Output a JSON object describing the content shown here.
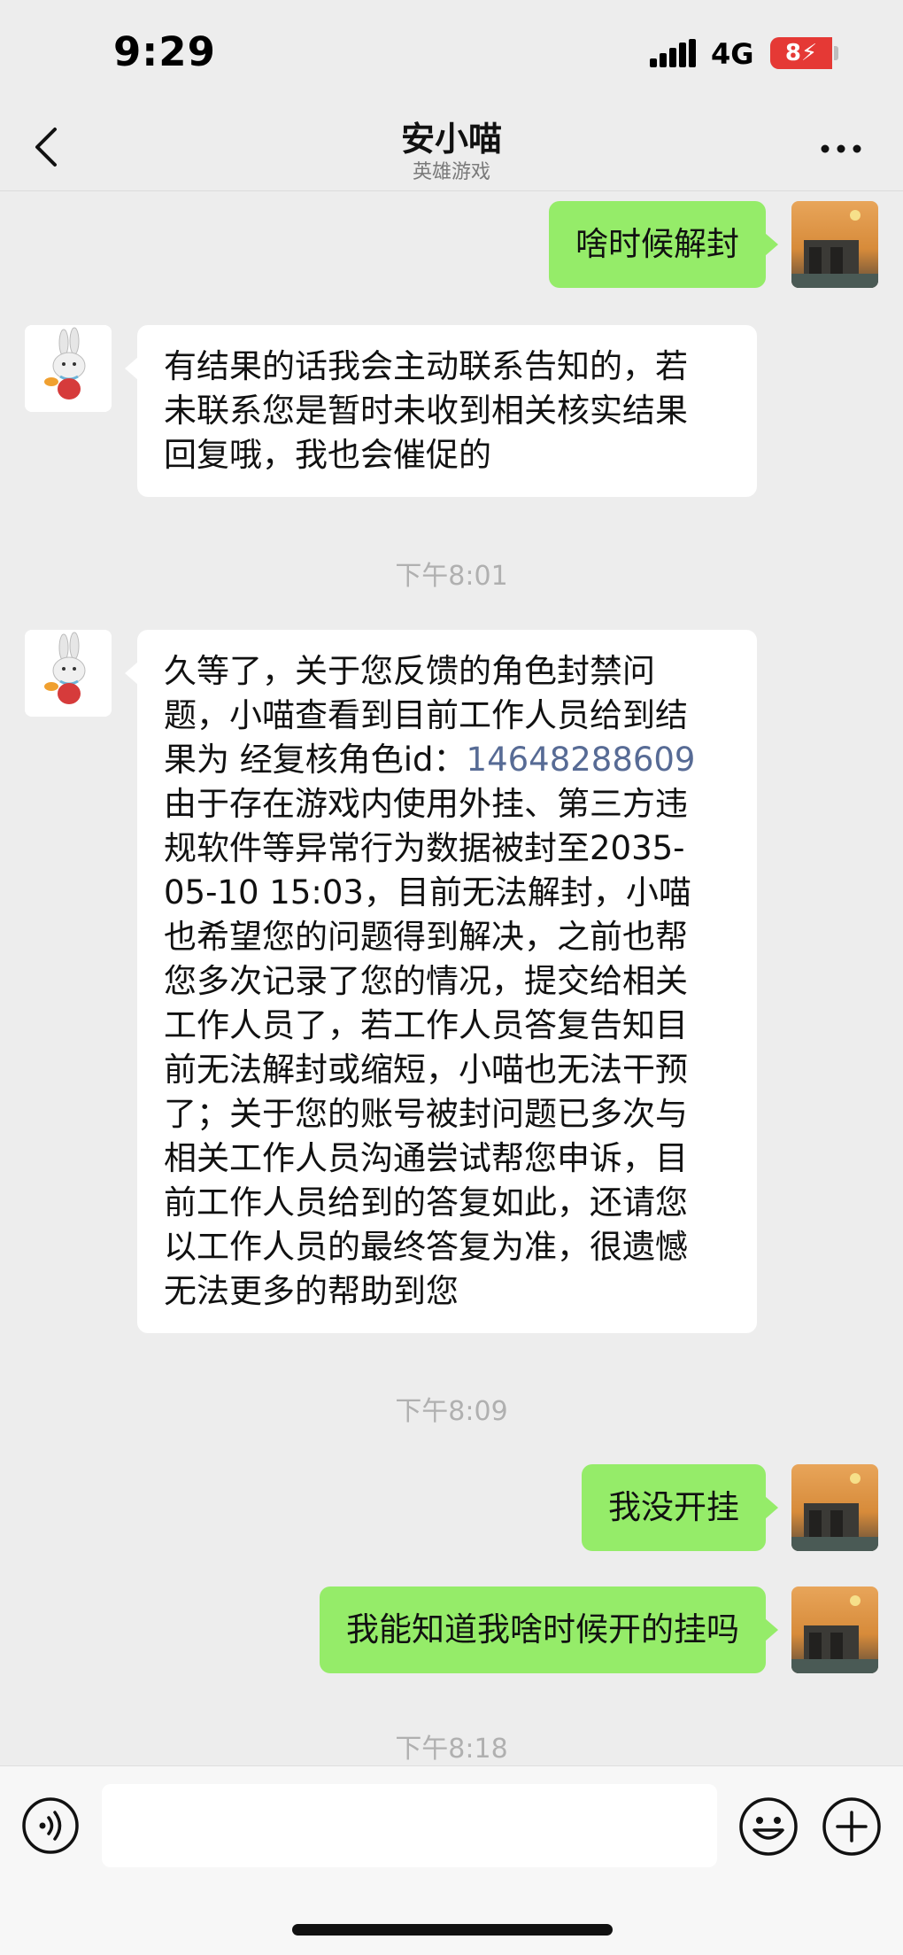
{
  "status_bar": {
    "time": "9:29",
    "network": "4G",
    "battery": "8"
  },
  "nav": {
    "title": "安小喵",
    "subtitle": "英雄游戏"
  },
  "colors": {
    "outgoing_bubble": "#95ec69",
    "incoming_bubble": "#ffffff",
    "link": "#576b95",
    "background": "#ededed"
  },
  "messages": [
    {
      "side": "out",
      "text": "啥时候解封"
    },
    {
      "side": "in",
      "lines": [
        "有结果的话我会主动联系告知的，若",
        "未联系您是暂时未收到相关核实结果",
        "回复哦，我也会催促的"
      ]
    },
    {
      "side": "in",
      "line1": "久等了，关于您反馈的角色封禁问",
      "line2": "题，小喵查看到目前工作人员给到结",
      "line3_prefix": "果为 经复核角色id：",
      "line3_link": "14648288609",
      "lines_rest": [
        "由于存在游戏内使用外挂、第三方违",
        "规软件等异常行为数据被封至2035-",
        "05-10 15:03，目前无法解封，小喵",
        "也希望您的问题得到解决，之前也帮",
        "您多次记录了您的情况，提交给相关",
        "工作人员了，若工作人员答复告知目",
        "前无法解封或缩短，小喵也无法干预",
        "了；关于您的账号被封问题已多次与",
        "相关工作人员沟通尝试帮您申诉，目",
        "前工作人员给到的答复如此，还请您",
        "以工作人员的最终答复为准，很遗憾",
        "无法更多的帮助到您"
      ]
    },
    {
      "side": "out",
      "text": "我没开挂"
    },
    {
      "side": "out",
      "text": "我能知道我啥时候开的挂吗"
    }
  ],
  "timestamps": [
    "下午8:01",
    "下午8:09",
    "下午8:18"
  ],
  "input": {
    "placeholder": ""
  },
  "icons": {
    "back": "chevron-left-icon",
    "more": "more-icon",
    "voice": "voice-icon",
    "emoji": "emoji-icon",
    "plus": "plus-icon"
  }
}
